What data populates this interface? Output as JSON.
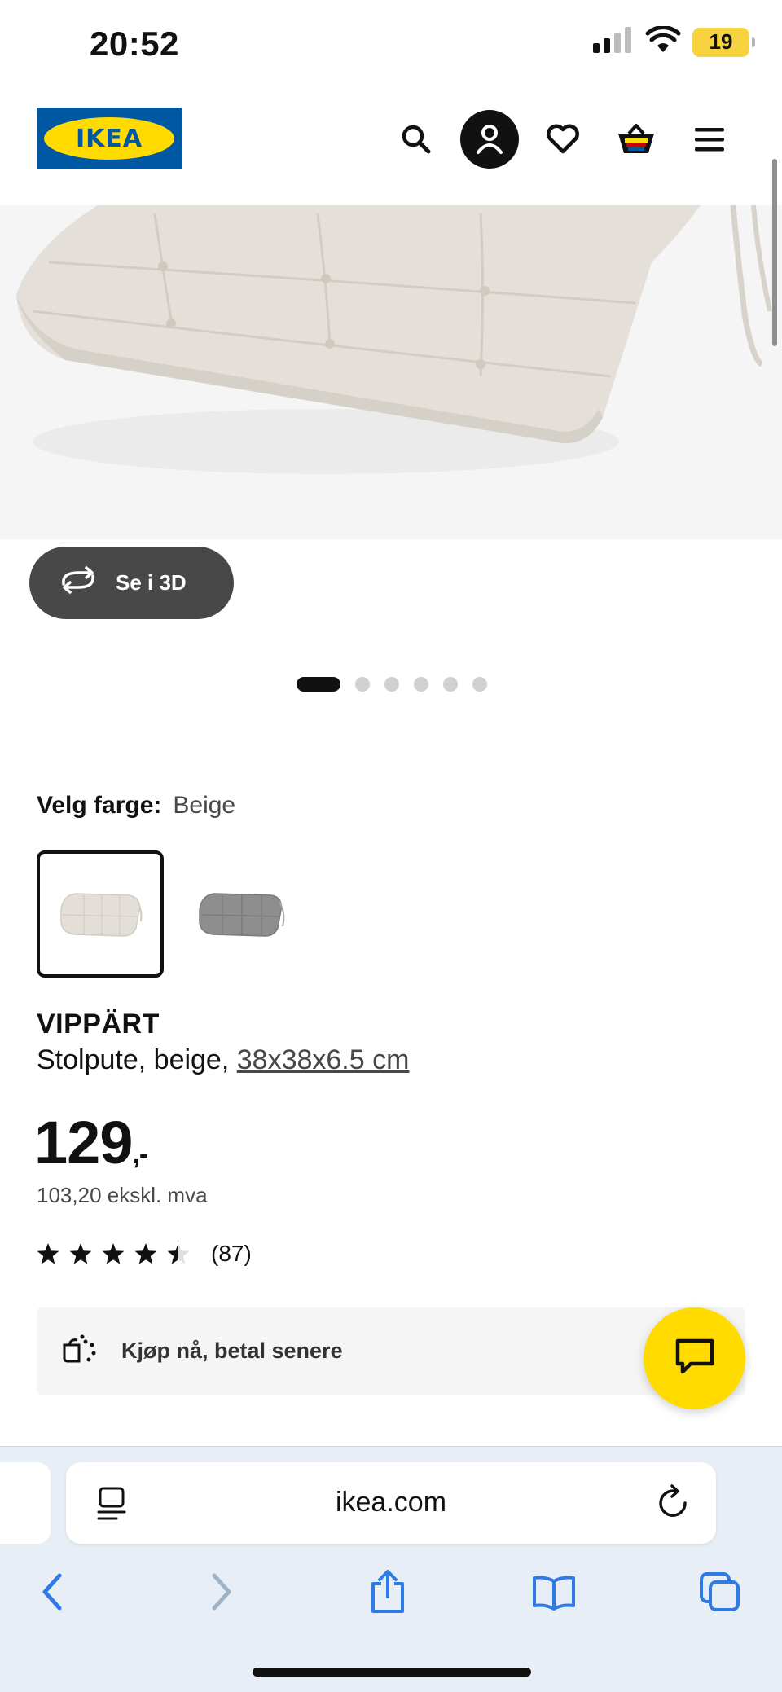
{
  "status_bar": {
    "time": "20:52",
    "battery": "19"
  },
  "header": {
    "logo": "IKEA",
    "icons": [
      "search-icon",
      "user-icon",
      "heart-icon",
      "basket-icon",
      "menu-icon"
    ]
  },
  "hero": {
    "view_3d_label": "Se i 3D",
    "carousel": {
      "total": 6,
      "active": 1
    }
  },
  "color_picker": {
    "label": "Velg farge:",
    "value": "Beige",
    "swatches": [
      "beige",
      "grey"
    ]
  },
  "product": {
    "name": "VIPPÄRT",
    "desc_prefix": "Stolpute, beige, ",
    "dimensions": "38x38x6.5 cm",
    "price_main": "129",
    "price_suffix": ",-",
    "price_ex_vat": "103,20 ekskl. mva",
    "rating": 4.5,
    "review_count": "(87)"
  },
  "bnpl": {
    "label": "Kjøp nå, betal senere"
  },
  "browser": {
    "url": "ikea.com"
  },
  "colors": {
    "ikea_blue": "#0058a3",
    "ikea_yellow": "#ffdb00",
    "safari_blue": "#2f7ae5"
  }
}
